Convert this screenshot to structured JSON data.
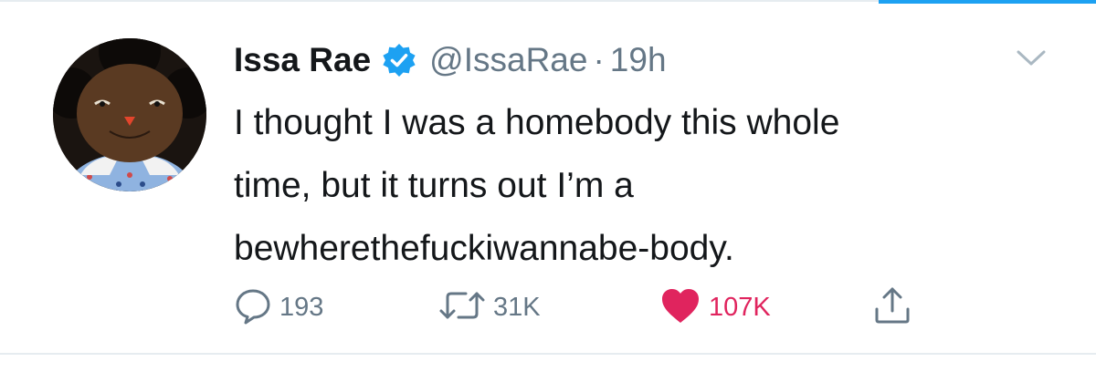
{
  "tweet": {
    "author": {
      "display_name": "Issa Rae",
      "handle": "@IssaRae",
      "verified": true
    },
    "separator": "·",
    "timestamp": "19h",
    "text_lines": [
      "I thought I was a homebody this whole",
      "time, but it turns out I’m a",
      "bewherethefuckiwannabe-body."
    ],
    "actions": {
      "replies": "193",
      "retweets": "31K",
      "likes": "107K",
      "liked": true
    }
  },
  "icons": {
    "reply": "reply-icon",
    "retweet": "retweet-icon",
    "like": "heart-icon",
    "share": "share-icon",
    "caret": "chevron-down-icon",
    "verified": "verified-badge-icon"
  },
  "colors": {
    "text": "#14171a",
    "secondary": "#657786",
    "brand": "#1da1f2",
    "like": "#e0245e",
    "border": "#e6ecf0"
  }
}
